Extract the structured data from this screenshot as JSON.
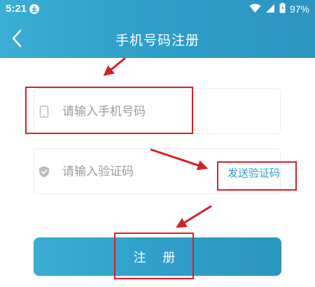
{
  "status_bar": {
    "time": "5:21",
    "battery_percent": "97%"
  },
  "header": {
    "title": "手机号码注册"
  },
  "form": {
    "phone_placeholder": "请输入手机号码",
    "code_placeholder": "请输入验证码",
    "send_code_label": "发送验证码",
    "register_label": "注 册"
  },
  "icons": {
    "status_bar": [
      "download-icon",
      "wifi-icon",
      "signal-icon",
      "battery-icon"
    ],
    "header": [
      "back-arrow-icon"
    ],
    "form": [
      "phone-icon",
      "shield-check-icon"
    ]
  },
  "colors": {
    "primary": "#2f9fca",
    "annotation": "#d62028",
    "placeholder": "#9c9c9c"
  }
}
